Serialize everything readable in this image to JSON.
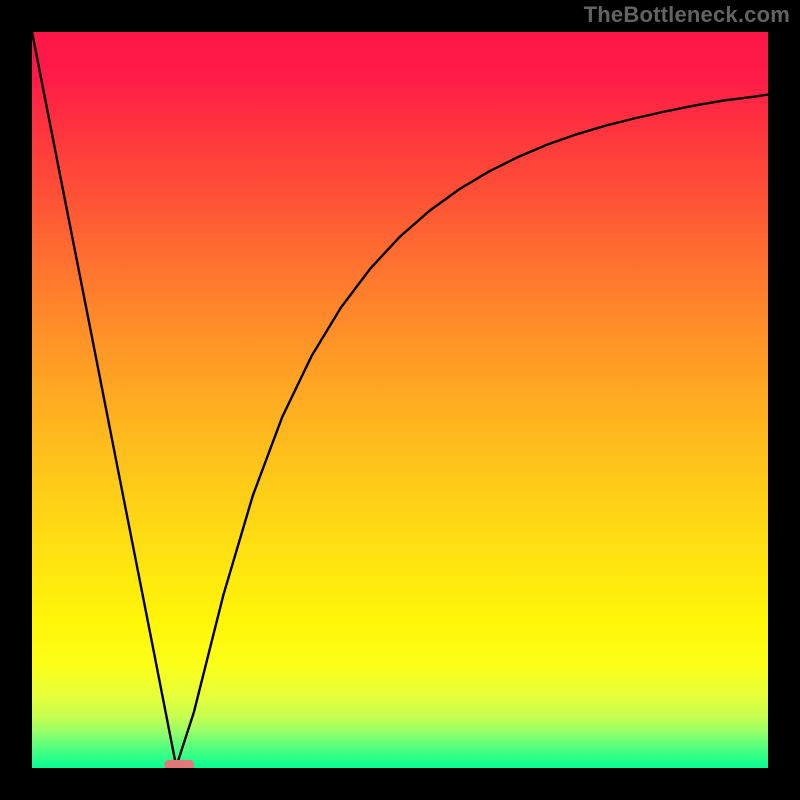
{
  "watermark": "TheBottleneck.com",
  "chart_data": {
    "type": "line",
    "title": "",
    "xlabel": "",
    "ylabel": "",
    "xlim": [
      0,
      1
    ],
    "ylim": [
      0,
      1
    ],
    "note": "Axes are unlabeled in the source image; values are normalized plot-area fractions (x right-positive, y up-positive). The curve is a V-shape with minimum at x≈0.196, y≈0.002.",
    "series": [
      {
        "name": "curve",
        "x": [
          0.0,
          0.04,
          0.08,
          0.12,
          0.16,
          0.196,
          0.22,
          0.26,
          0.3,
          0.34,
          0.38,
          0.42,
          0.46,
          0.5,
          0.54,
          0.58,
          0.62,
          0.66,
          0.7,
          0.74,
          0.78,
          0.82,
          0.86,
          0.9,
          0.94,
          0.98,
          1.0
        ],
        "y": [
          1.0,
          0.796,
          0.593,
          0.389,
          0.186,
          0.002,
          0.076,
          0.235,
          0.37,
          0.477,
          0.56,
          0.626,
          0.679,
          0.722,
          0.757,
          0.786,
          0.81,
          0.83,
          0.847,
          0.861,
          0.873,
          0.883,
          0.892,
          0.9,
          0.907,
          0.912,
          0.915
        ]
      }
    ],
    "min_marker": {
      "x": 0.2,
      "y": 0.003,
      "half_w": 0.02,
      "half_h": 0.008,
      "color": "#e07a7a"
    },
    "gradient_stops": [
      {
        "pos": 0.0,
        "color": "#ff1648"
      },
      {
        "pos": 0.5,
        "color": "#ffb020"
      },
      {
        "pos": 0.8,
        "color": "#fff608"
      },
      {
        "pos": 1.0,
        "color": "#08ff93"
      }
    ]
  }
}
